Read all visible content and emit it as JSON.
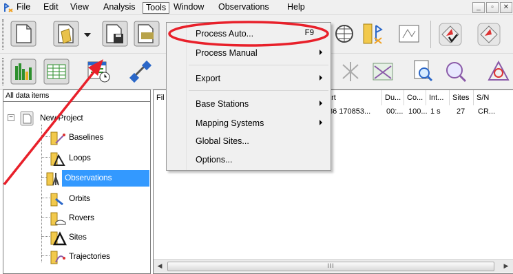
{
  "menubar": {
    "items": [
      "File",
      "Edit",
      "View",
      "Analysis",
      "Tools",
      "Window",
      "Observations",
      "Help"
    ],
    "active": "Tools",
    "window_buttons": [
      "_",
      "▫",
      "✕"
    ]
  },
  "tools_menu": {
    "items": [
      {
        "label": "Process Auto...",
        "shortcut": "F9"
      },
      {
        "label": "Process Manual",
        "submenu": true
      },
      {
        "label": "Export",
        "submenu": true
      },
      {
        "label": "Base Stations",
        "submenu": true
      },
      {
        "label": "Mapping Systems",
        "submenu": true
      },
      {
        "label": "Global Sites..."
      },
      {
        "label": "Options..."
      }
    ]
  },
  "tree": {
    "header": "All data items",
    "root": "New Project",
    "expander": "−",
    "children": [
      "Baselines",
      "Loops",
      "Observations",
      "Orbits",
      "Rovers",
      "Sites",
      "Trajectories"
    ],
    "selected": "Observations"
  },
  "list": {
    "columns": [
      "File",
      "Start",
      "Du...",
      "Co...",
      "Int...",
      "Sites",
      "S/N"
    ],
    "visible_column_text": [
      "Fil",
      "art",
      "Du...",
      "Co...",
      "Int...",
      "Sites",
      "S/N"
    ],
    "rows": [
      {
        "start": "86 170853...",
        "duration": "00:...",
        "co": "100...",
        "interval": "1 s",
        "sites": "27",
        "sn": "CR..."
      }
    ],
    "scroll_left": "◀",
    "scroll_right": "▶",
    "scroll_grip": "III"
  },
  "annotation": {
    "ellipse_color": "#e8202a",
    "arrow_color": "#e8202a"
  }
}
